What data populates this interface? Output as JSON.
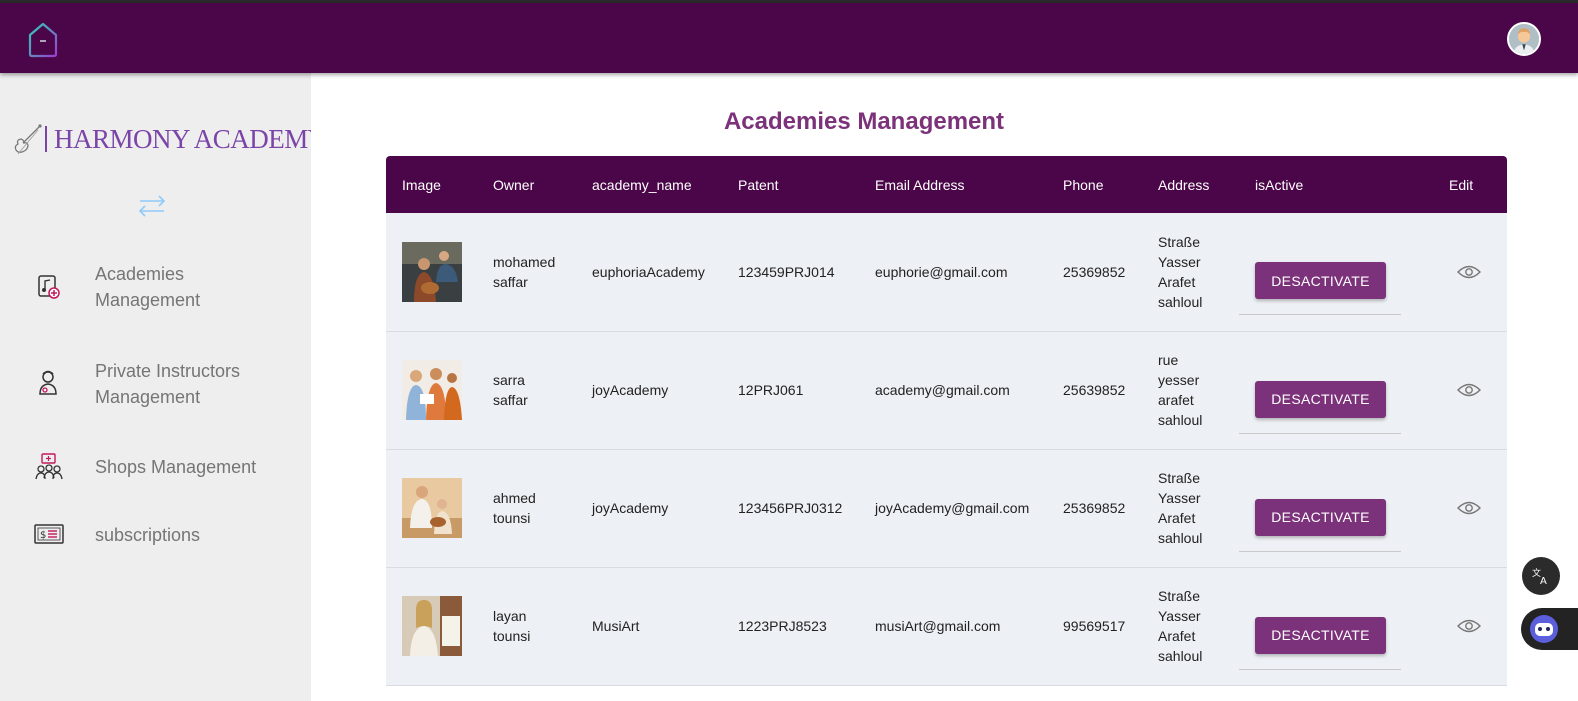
{
  "brand": {
    "name": "HARMONY ACADEMY"
  },
  "sidebar": {
    "items": [
      {
        "label": "Academies Management",
        "icon": "music-note-plus-icon"
      },
      {
        "label": "Private Instructors Management",
        "icon": "instructor-icon"
      },
      {
        "label": "Shops Management",
        "icon": "shop-people-icon"
      },
      {
        "label": "subscriptions",
        "icon": "dollar-bill-icon"
      }
    ]
  },
  "page": {
    "title": "Academies Management"
  },
  "table": {
    "headers": [
      "Image",
      "Owner",
      "academy_name",
      "Patent",
      "Email Address",
      "Phone",
      "Address",
      "isActive",
      "Edit"
    ],
    "rows": [
      {
        "owner": "mohamed saffar",
        "academy_name": "euphoriaAcademy",
        "patent": "123459PRJ014",
        "email": "euphorie@gmail.com",
        "phone": "25369852",
        "address": "Straße Yasser Arafet sahloul",
        "action": "DESACTIVATE"
      },
      {
        "owner": "sarra saffar",
        "academy_name": "joyAcademy",
        "patent": "12PRJ061",
        "email": "academy@gmail.com",
        "phone": "25639852",
        "address": "rue yesser arafet sahloul",
        "action": "DESACTIVATE"
      },
      {
        "owner": "ahmed tounsi",
        "academy_name": "joyAcademy",
        "patent": "123456PRJ0312",
        "email": "joyAcademy@gmail.com",
        "phone": "25369852",
        "address": "Straße Yasser Arafet sahloul",
        "action": "DESACTIVATE"
      },
      {
        "owner": "layan tounsi",
        "academy_name": "MusiArt",
        "patent": "1223PRJ8523",
        "email": "musiArt@gmail.com",
        "phone": "99569517",
        "address": "Straße Yasser Arafet sahloul",
        "action": "DESACTIVATE"
      }
    ]
  },
  "colors": {
    "header": "#4a0648",
    "accent": "#7b327a",
    "brand": "#7b44a8",
    "sidebar": "#eeeeee",
    "row": "#edf0f4"
  }
}
